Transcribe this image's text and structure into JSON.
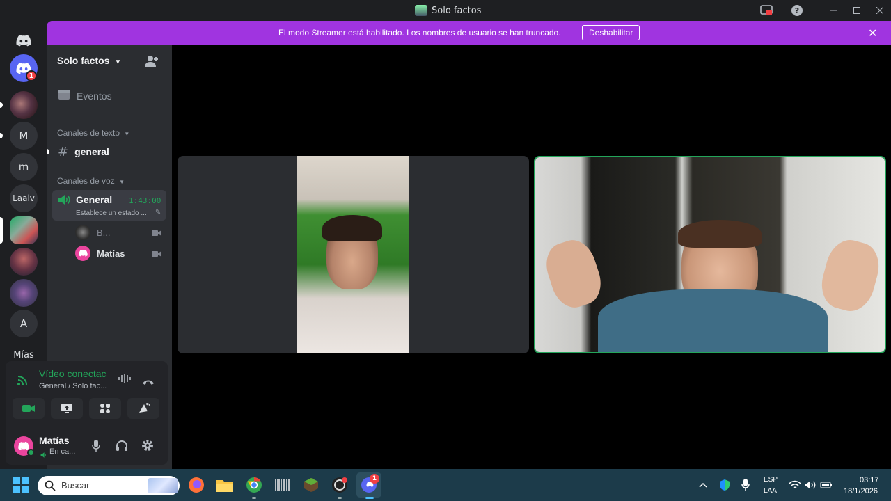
{
  "window": {
    "title": "Solo factos"
  },
  "banner": {
    "message": "El modo Streamer está habilitado. Los nombres de usuario se han truncado.",
    "button": "Deshabilitar"
  },
  "rail": {
    "home_badge": "1",
    "servers": [
      {
        "label": "M"
      },
      {
        "label": "m"
      },
      {
        "label": "Laalv"
      },
      {
        "label": "A"
      },
      {
        "label": "Mías"
      }
    ]
  },
  "sidebar": {
    "server_name": "Solo factos",
    "events": "Eventos",
    "text_category": "Canales de texto",
    "text_channel": "general",
    "voice_category": "Canales de voz",
    "voice_channel": "General",
    "voice_timer": "1:43:00",
    "voice_status": "Establece un estado ...",
    "members": [
      {
        "name": "B..."
      },
      {
        "name": "Matías"
      }
    ]
  },
  "voice_panel": {
    "status": "Vídeo conectac",
    "location": "General / Solo fac..."
  },
  "user": {
    "name": "Matías",
    "status": "En ca..."
  },
  "taskbar": {
    "search_placeholder": "Buscar",
    "lang_top": "ESP",
    "lang_bottom": "LAA",
    "time": "03:17",
    "date": "18/1/2026",
    "discord_badge": "1"
  },
  "colors": {
    "banner": "#a034e0",
    "accent_green": "#23a55a",
    "discord_blurple": "#5865f2"
  }
}
